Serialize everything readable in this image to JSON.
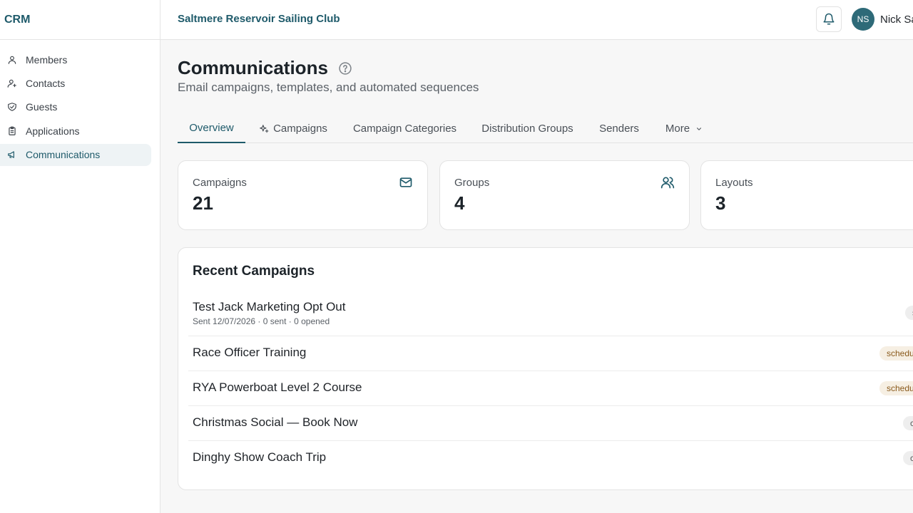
{
  "brand": "CRM",
  "club_name": "Saltmere Reservoir Sailing Club",
  "user": {
    "initials": "NS",
    "name": "Nick Sa"
  },
  "sidebar": {
    "items": [
      {
        "label": "Members",
        "icon": "user-icon"
      },
      {
        "label": "Contacts",
        "icon": "user-plus-icon"
      },
      {
        "label": "Guests",
        "icon": "badge-check-icon"
      },
      {
        "label": "Applications",
        "icon": "clipboard-icon"
      },
      {
        "label": "Communications",
        "icon": "megaphone-icon",
        "active": true
      }
    ]
  },
  "page": {
    "title": "Communications",
    "subtitle": "Email campaigns, templates, and automated sequences"
  },
  "tabs": [
    {
      "label": "Overview",
      "active": true
    },
    {
      "label": "Campaigns",
      "icon": "sparkles-icon"
    },
    {
      "label": "Campaign Categories"
    },
    {
      "label": "Distribution Groups"
    },
    {
      "label": "Senders"
    },
    {
      "label": "More",
      "icon": "chevron-down-icon"
    }
  ],
  "stats": [
    {
      "label": "Campaigns",
      "value": "21",
      "icon": "mail-icon"
    },
    {
      "label": "Groups",
      "value": "4",
      "icon": "users-icon"
    },
    {
      "label": "Layouts",
      "value": "3"
    }
  ],
  "recent": {
    "title": "Recent Campaigns",
    "rows": [
      {
        "name": "Test Jack Marketing Opt Out",
        "meta": "Sent 12/07/2026 · 0 sent · 0 opened",
        "badge": "s"
      },
      {
        "name": "Race Officer Training",
        "badge": "schedu"
      },
      {
        "name": "RYA Powerboat Level 2 Course",
        "badge": "schedu"
      },
      {
        "name": "Christmas Social — Book Now",
        "badge": "c"
      },
      {
        "name": "Dinghy Show Coach Trip",
        "badge": "c"
      }
    ]
  },
  "colors": {
    "accent": "#1e5a6a",
    "avatar": "#2e6a78",
    "active_bg": "#eef3f5"
  }
}
